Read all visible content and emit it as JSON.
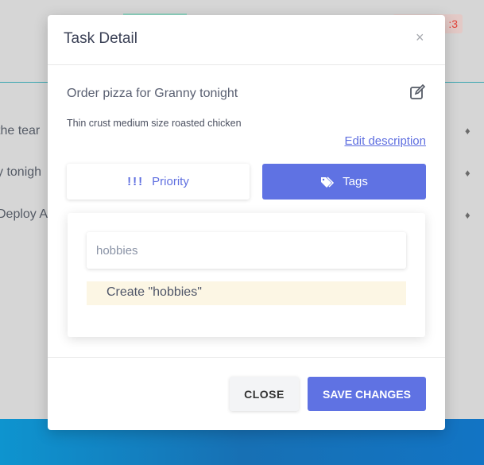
{
  "background": {
    "badge_text": ":3",
    "rows": [
      "the tear",
      "y tonigh",
      "Deploy A"
    ]
  },
  "modal": {
    "title": "Task Detail",
    "close_glyph": "×",
    "task_name": "Order pizza for Granny tonight",
    "description": "Thin crust medium size roasted chicken",
    "edit_description_label": "Edit description",
    "priority_icon": "!!!",
    "priority_label": "Priority",
    "tags_label": "Tags",
    "tag_input_value": "hobbies",
    "create_option": "Create \"hobbies\"",
    "close_button": "CLOSE",
    "save_button": "SAVE CHANGES"
  },
  "colors": {
    "accent": "#5f72e3",
    "highlight": "#fcf6e4"
  }
}
